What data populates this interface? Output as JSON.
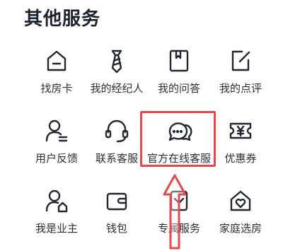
{
  "section": {
    "title": "其他服务"
  },
  "services": [
    [
      {
        "label": "找房卡",
        "icon": "house-card-icon"
      },
      {
        "label": "我的经纪人",
        "icon": "tie-icon"
      },
      {
        "label": "我的问答",
        "icon": "book-icon"
      },
      {
        "label": "我的点评",
        "icon": "edit-icon"
      }
    ],
    [
      {
        "label": "用户反馈",
        "icon": "user-feedback-icon"
      },
      {
        "label": "联系客服",
        "icon": "headset-icon"
      },
      {
        "label": "官方在线客服",
        "icon": "chat-bubbles-icon"
      },
      {
        "label": "优惠券",
        "icon": "coupon-icon"
      }
    ],
    [
      {
        "label": "我是业主",
        "icon": "owner-icon"
      },
      {
        "label": "钱包",
        "icon": "wallet-icon"
      },
      {
        "label": "专属服务",
        "icon": "exclusive-service-icon"
      },
      {
        "label": "家庭选房",
        "icon": "family-home-icon"
      }
    ]
  ],
  "colors": {
    "icon_stroke": "#1f2733",
    "highlight": "#e8474b"
  }
}
